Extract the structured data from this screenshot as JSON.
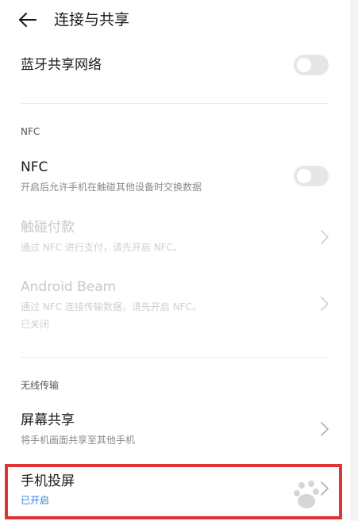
{
  "header": {
    "title": "连接与共享",
    "back_icon": "arrow-left-icon"
  },
  "bluetooth_tethering": {
    "title": "蓝牙共享网络",
    "enabled": false
  },
  "nfc_section": {
    "label": "NFC",
    "nfc": {
      "title": "NFC",
      "subtitle": "开启后允许手机在触碰其他设备时交换数据",
      "enabled": false
    },
    "tap_pay": {
      "title": "触碰付款",
      "subtitle": "通过 NFC 进行支付，请先开启 NFC。"
    },
    "android_beam": {
      "title": "Android Beam",
      "subtitle": "通过 NFC 连接传输数据，请先开启 NFC。",
      "status": "已关闭"
    }
  },
  "wireless_section": {
    "label": "无线传输",
    "screen_share": {
      "title": "屏幕共享",
      "subtitle": "将手机画面共享至其他手机"
    },
    "screen_cast": {
      "title": "手机投屏",
      "status": "已开启"
    }
  },
  "colors": {
    "highlight_border": "#e03333",
    "active_status": "#2f7be5",
    "toggle_off": "#e6e6e6"
  }
}
